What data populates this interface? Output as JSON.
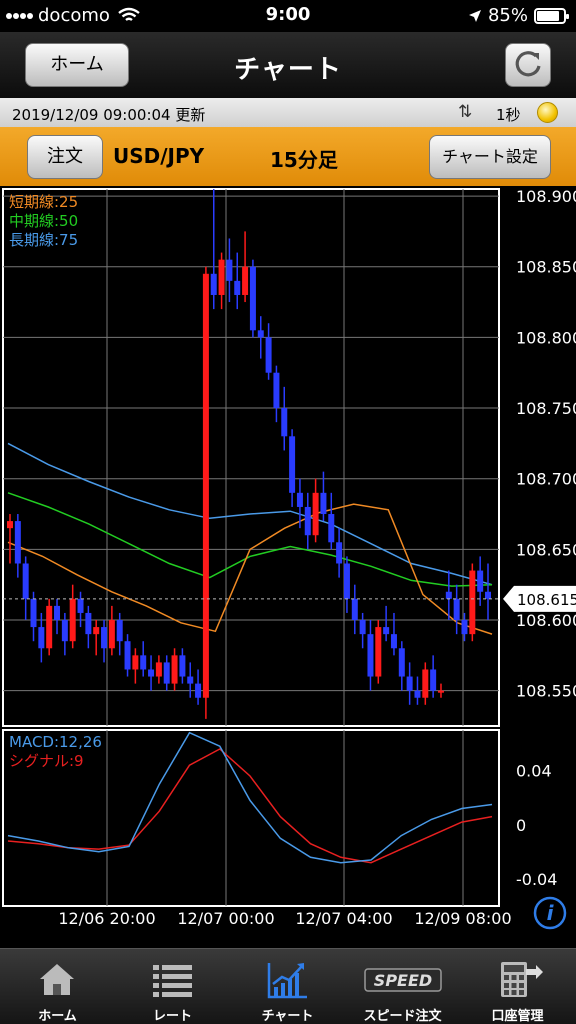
{
  "status": {
    "carrier": "docomo",
    "time": "9:00",
    "battery": "85%"
  },
  "header": {
    "title": "チャート",
    "home_label": "ホーム"
  },
  "update": {
    "timestamp": "2019/12/09 09:00:04",
    "label": "更新",
    "interval": "1秒"
  },
  "order": {
    "order_label": "注文",
    "pair": "USD/JPY",
    "timeframe": "15分足",
    "settings_label": "チャート設定"
  },
  "chart": {
    "price_ticks": [
      "108.900",
      "108.850",
      "108.800",
      "108.750",
      "108.700",
      "108.650",
      "108.600",
      "108.550"
    ],
    "current_price": "108.615",
    "ma_legend": [
      {
        "label": "短期線:25",
        "color": "#f08a24"
      },
      {
        "label": "中期線:50",
        "color": "#22cc22"
      },
      {
        "label": "長期線:75",
        "color": "#4a9ae8"
      }
    ],
    "macd_legend": [
      {
        "label": "MACD:12,26",
        "color": "#4a9ae8"
      },
      {
        "label": "シグナル:9",
        "color": "#e82020"
      }
    ],
    "macd_ticks": [
      "0.04",
      "0",
      "-0.04"
    ],
    "time_labels": [
      "12/06 20:00",
      "12/07 00:00",
      "12/07 04:00",
      "12/09 08:00"
    ],
    "colors": {
      "up": "#ff1a1a",
      "down": "#2a3cff",
      "grid": "#777777",
      "frame": "#ffffff"
    }
  },
  "chart_data": {
    "type": "candlestick",
    "instrument": "USD/JPY",
    "timeframe": "15分足",
    "ylim": [
      108.525,
      108.905
    ],
    "x_ticks": [
      "12/06 20:00",
      "12/07 00:00",
      "12/07 04:00",
      "12/09 08:00"
    ],
    "candles": [
      [
        108.665,
        108.675,
        108.64,
        108.67
      ],
      [
        108.67,
        108.675,
        108.63,
        108.64
      ],
      [
        108.64,
        108.645,
        108.6,
        108.615
      ],
      [
        108.615,
        108.62,
        108.585,
        108.595
      ],
      [
        108.595,
        108.605,
        108.57,
        108.58
      ],
      [
        108.58,
        108.615,
        108.575,
        108.61
      ],
      [
        108.61,
        108.615,
        108.59,
        108.6
      ],
      [
        108.6,
        108.605,
        108.575,
        108.585
      ],
      [
        108.585,
        108.625,
        108.58,
        108.615
      ],
      [
        108.615,
        108.62,
        108.595,
        108.605
      ],
      [
        108.605,
        108.61,
        108.58,
        108.59
      ],
      [
        108.59,
        108.6,
        108.575,
        108.595
      ],
      [
        108.595,
        108.6,
        108.57,
        108.58
      ],
      [
        108.58,
        108.61,
        108.575,
        108.6
      ],
      [
        108.6,
        108.605,
        108.575,
        108.585
      ],
      [
        108.585,
        108.59,
        108.56,
        108.565
      ],
      [
        108.565,
        108.58,
        108.555,
        108.575
      ],
      [
        108.575,
        108.585,
        108.56,
        108.565
      ],
      [
        108.565,
        108.575,
        108.55,
        108.56
      ],
      [
        108.56,
        108.575,
        108.555,
        108.57
      ],
      [
        108.57,
        108.575,
        108.55,
        108.555
      ],
      [
        108.555,
        108.58,
        108.55,
        108.575
      ],
      [
        108.575,
        108.58,
        108.555,
        108.56
      ],
      [
        108.56,
        108.57,
        108.545,
        108.555
      ],
      [
        108.555,
        108.565,
        108.54,
        108.545
      ],
      [
        108.545,
        108.85,
        108.53,
        108.845
      ],
      [
        108.845,
        108.905,
        108.82,
        108.83
      ],
      [
        108.83,
        108.86,
        108.82,
        108.855
      ],
      [
        108.855,
        108.87,
        108.825,
        108.84
      ],
      [
        108.84,
        108.86,
        108.82,
        108.83
      ],
      [
        108.83,
        108.875,
        108.825,
        108.85
      ],
      [
        108.85,
        108.855,
        108.8,
        108.805
      ],
      [
        108.805,
        108.815,
        108.785,
        108.8
      ],
      [
        108.8,
        108.81,
        108.77,
        108.775
      ],
      [
        108.775,
        108.78,
        108.74,
        108.75
      ],
      [
        108.75,
        108.765,
        108.72,
        108.73
      ],
      [
        108.73,
        108.735,
        108.68,
        108.69
      ],
      [
        108.69,
        108.7,
        108.665,
        108.68
      ],
      [
        108.68,
        108.69,
        108.65,
        108.66
      ],
      [
        108.66,
        108.7,
        108.655,
        108.69
      ],
      [
        108.69,
        108.705,
        108.67,
        108.675
      ],
      [
        108.675,
        108.69,
        108.65,
        108.655
      ],
      [
        108.655,
        108.665,
        108.63,
        108.64
      ],
      [
        108.64,
        108.645,
        108.605,
        108.615
      ],
      [
        108.615,
        108.625,
        108.59,
        108.6
      ],
      [
        108.6,
        108.605,
        108.58,
        108.59
      ],
      [
        108.59,
        108.6,
        108.55,
        108.56
      ],
      [
        108.56,
        108.6,
        108.555,
        108.595
      ],
      [
        108.595,
        108.61,
        108.585,
        108.59
      ],
      [
        108.59,
        108.605,
        108.575,
        108.58
      ],
      [
        108.58,
        108.585,
        108.55,
        108.56
      ],
      [
        108.56,
        108.57,
        108.54,
        108.55
      ],
      [
        108.55,
        108.56,
        108.54,
        108.545
      ],
      [
        108.545,
        108.57,
        108.54,
        108.565
      ],
      [
        108.565,
        108.575,
        108.545,
        108.55
      ],
      [
        108.55,
        108.555,
        108.545,
        108.55
      ],
      [
        108.62,
        108.635,
        108.6,
        108.615
      ],
      [
        108.615,
        108.625,
        108.59,
        108.6
      ],
      [
        108.6,
        108.605,
        108.585,
        108.59
      ],
      [
        108.59,
        108.64,
        108.585,
        108.635
      ],
      [
        108.635,
        108.645,
        108.61,
        108.62
      ],
      [
        108.62,
        108.64,
        108.6,
        108.615
      ]
    ],
    "ma_short": [
      108.655,
      108.645,
      108.632,
      108.62,
      108.61,
      108.598,
      108.592,
      108.65,
      108.665,
      108.676,
      108.682,
      108.678,
      108.618,
      108.598,
      108.59
    ],
    "ma_mid": [
      108.69,
      108.68,
      108.668,
      108.654,
      108.64,
      108.63,
      108.645,
      108.652,
      108.646,
      108.638,
      108.628,
      108.624,
      108.625
    ],
    "ma_long": [
      108.725,
      108.71,
      108.698,
      108.687,
      108.678,
      108.672,
      108.675,
      108.677,
      108.668,
      108.654,
      108.64,
      108.633,
      108.625
    ],
    "macd": [
      -0.008,
      -0.012,
      -0.017,
      -0.02,
      -0.016,
      0.03,
      0.068,
      0.058,
      0.018,
      -0.01,
      -0.024,
      -0.028,
      -0.026,
      -0.008,
      0.004,
      0.012,
      0.015
    ],
    "signal": [
      -0.012,
      -0.014,
      -0.017,
      -0.018,
      -0.015,
      0.01,
      0.044,
      0.056,
      0.036,
      0.006,
      -0.014,
      -0.024,
      -0.028,
      -0.018,
      -0.008,
      0.002,
      0.006
    ],
    "macd_ylim": [
      -0.06,
      0.07
    ]
  }
}
